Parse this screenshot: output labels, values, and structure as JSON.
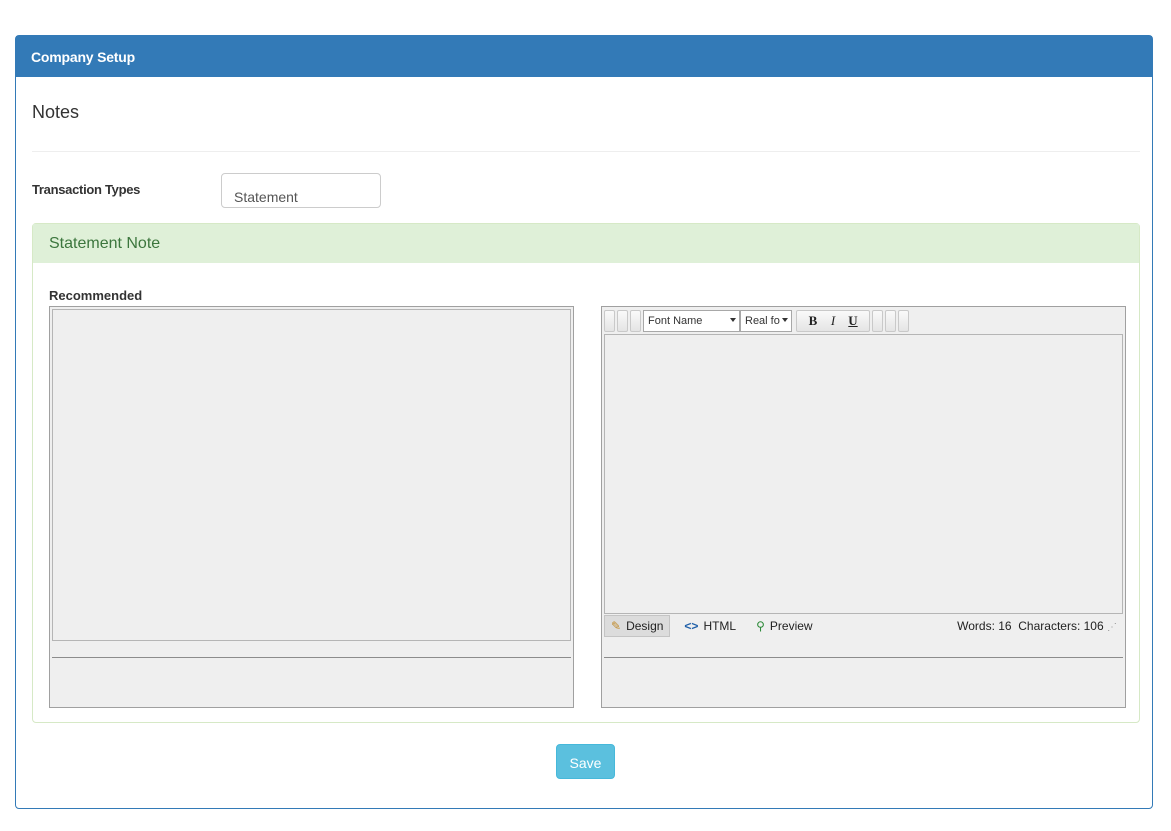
{
  "panel": {
    "title": "Company Setup"
  },
  "notes": {
    "title": "Notes"
  },
  "transaction": {
    "label": "Transaction Types",
    "value": "Statement"
  },
  "statement_note": {
    "title": "Statement Note",
    "recommended_label": "Recommended"
  },
  "editor": {
    "font_name": "Font Name",
    "font_size": "Real fo",
    "bold": "B",
    "italic": "I",
    "underline": "U",
    "modes": [
      "Design",
      "HTML",
      "Preview"
    ],
    "words_label": "Words: 16",
    "characters_label": "Characters: 106"
  },
  "actions": {
    "save": "Save"
  },
  "colors": {
    "primary": "#337ab7",
    "success_bg": "#dff0d8",
    "success_text": "#3c763d",
    "info": "#5bc0de"
  }
}
